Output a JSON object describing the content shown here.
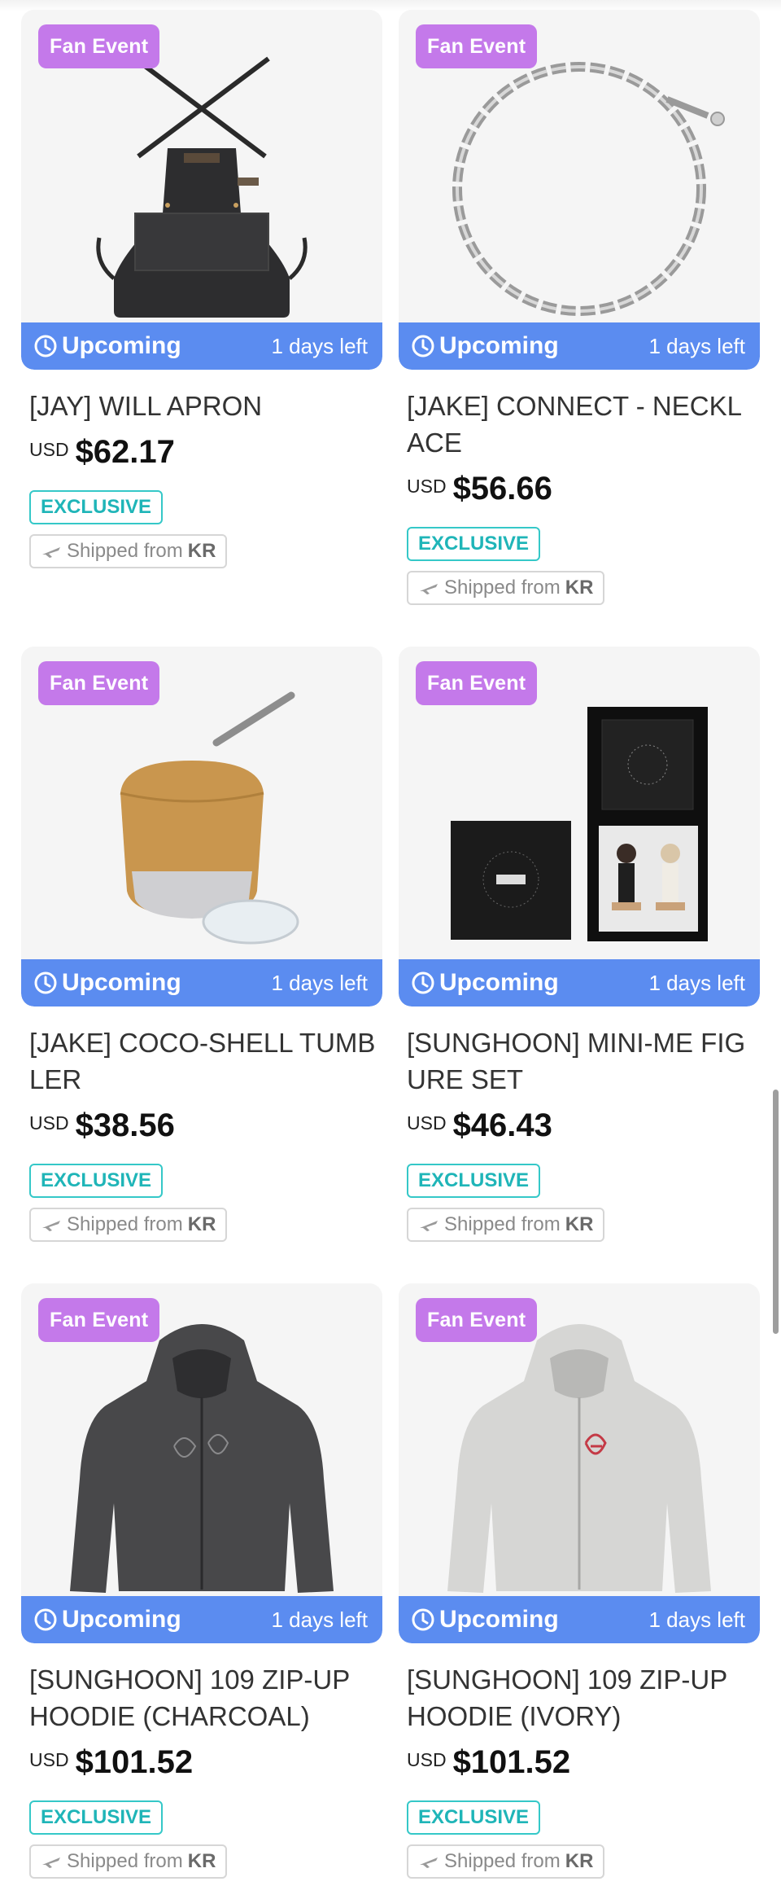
{
  "colors": {
    "badge": "#c479ea",
    "status": "#5b8cf0",
    "exclusive": "#1fb5b8"
  },
  "products": [
    {
      "badge": "Fan Event",
      "status": "Upcoming",
      "days_left": "1 days left",
      "name": "[JAY] WILL APRON",
      "currency": "USD",
      "price": "$62.17",
      "tag": "EXCLUSIVE",
      "ship_prefix": "Shipped from",
      "ship_origin": "KR",
      "image": "black-apron"
    },
    {
      "badge": "Fan Event",
      "status": "Upcoming",
      "days_left": "1 days left",
      "name": "[JAKE] CONNECT - NECKLACE",
      "currency": "USD",
      "price": "$56.66",
      "tag": "EXCLUSIVE",
      "ship_prefix": "Shipped from",
      "ship_origin": "KR",
      "image": "silver-chain-necklace"
    },
    {
      "badge": "Fan Event",
      "status": "Upcoming",
      "days_left": "1 days left",
      "name": "[JAKE] COCO-SHELL TUMBLER",
      "currency": "USD",
      "price": "$38.56",
      "tag": "EXCLUSIVE",
      "ship_prefix": "Shipped from",
      "ship_origin": "KR",
      "image": "bamboo-tumbler-with-straw"
    },
    {
      "badge": "Fan Event",
      "status": "Upcoming",
      "days_left": "1 days left",
      "name": "[SUNGHOON] MINI-ME FIGURE SET",
      "currency": "USD",
      "price": "$46.43",
      "tag": "EXCLUSIVE",
      "ship_prefix": "Shipped from",
      "ship_origin": "KR",
      "image": "figure-set-box"
    },
    {
      "badge": "Fan Event",
      "status": "Upcoming",
      "days_left": "1 days left",
      "name": "[SUNGHOON] 109 ZIP-UP HOODIE (CHARCOAL)",
      "currency": "USD",
      "price": "$101.52",
      "tag": "EXCLUSIVE",
      "ship_prefix": "Shipped from",
      "ship_origin": "KR",
      "image": "charcoal-hoodie"
    },
    {
      "badge": "Fan Event",
      "status": "Upcoming",
      "days_left": "1 days left",
      "name": "[SUNGHOON] 109 ZIP-UP HOODIE (IVORY)",
      "currency": "USD",
      "price": "$101.52",
      "tag": "EXCLUSIVE",
      "ship_prefix": "Shipped from",
      "ship_origin": "KR",
      "image": "ivory-hoodie"
    }
  ]
}
